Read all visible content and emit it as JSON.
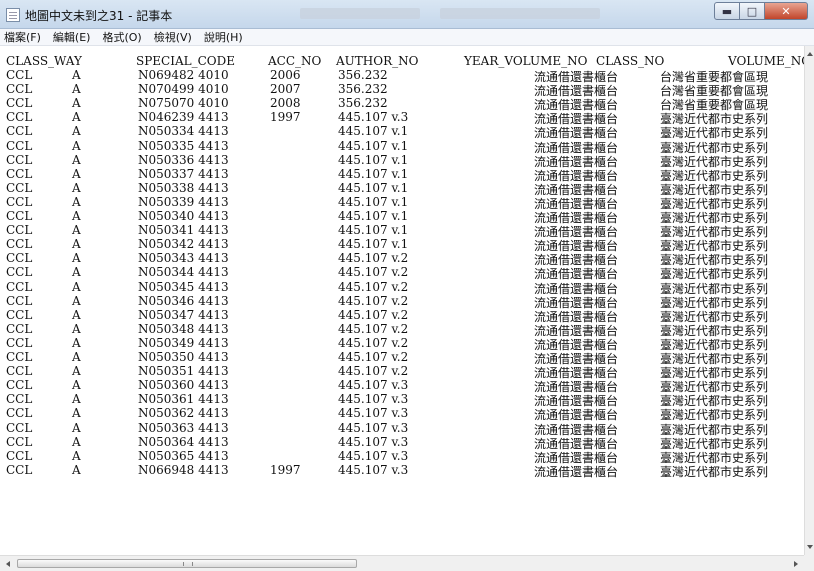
{
  "window": {
    "title": "地圖中文未到之31 - 記事本",
    "controls": {
      "minimize_icon": "minimize-icon",
      "maximize_icon": "maximize-icon",
      "close_icon": "close-icon"
    }
  },
  "menu": [
    "檔案(F)",
    "編輯(E)",
    "格式(O)",
    "檢視(V)",
    "說明(H)"
  ],
  "columns": [
    "CLASS_WAY",
    "SPECIAL_CODE",
    "ACC_NO",
    "AUTHOR_NO",
    "YEAR_VOLUME_NO",
    "CLASS_NO",
    "VOLUME_NO"
  ],
  "rows": [
    [
      "CCL",
      "A",
      "N069482 4010",
      "2006",
      "356.232",
      "",
      "流通借還書櫃台",
      "台灣省重要都會區現"
    ],
    [
      "CCL",
      "A",
      "N070499 4010",
      "2007",
      "356.232",
      "",
      "流通借還書櫃台",
      "台灣省重要都會區現"
    ],
    [
      "CCL",
      "A",
      "N075070 4010",
      "2008",
      "356.232",
      "",
      "流通借還書櫃台",
      "台灣省重要都會區現"
    ],
    [
      "CCL",
      "A",
      "N046239 4413",
      "1997",
      "445.107 v.3",
      "",
      "流通借還書櫃台",
      "臺灣近代都市史系列"
    ],
    [
      "CCL",
      "A",
      "N050334 4413",
      "",
      "445.107 v.1",
      "",
      "流通借還書櫃台",
      "臺灣近代都市史系列"
    ],
    [
      "CCL",
      "A",
      "N050335 4413",
      "",
      "445.107 v.1",
      "",
      "流通借還書櫃台",
      "臺灣近代都市史系列"
    ],
    [
      "CCL",
      "A",
      "N050336 4413",
      "",
      "445.107 v.1",
      "",
      "流通借還書櫃台",
      "臺灣近代都市史系列"
    ],
    [
      "CCL",
      "A",
      "N050337 4413",
      "",
      "445.107 v.1",
      "",
      "流通借還書櫃台",
      "臺灣近代都市史系列"
    ],
    [
      "CCL",
      "A",
      "N050338 4413",
      "",
      "445.107 v.1",
      "",
      "流通借還書櫃台",
      "臺灣近代都市史系列"
    ],
    [
      "CCL",
      "A",
      "N050339 4413",
      "",
      "445.107 v.1",
      "",
      "流通借還書櫃台",
      "臺灣近代都市史系列"
    ],
    [
      "CCL",
      "A",
      "N050340 4413",
      "",
      "445.107 v.1",
      "",
      "流通借還書櫃台",
      "臺灣近代都市史系列"
    ],
    [
      "CCL",
      "A",
      "N050341 4413",
      "",
      "445.107 v.1",
      "",
      "流通借還書櫃台",
      "臺灣近代都市史系列"
    ],
    [
      "CCL",
      "A",
      "N050342 4413",
      "",
      "445.107 v.1",
      "",
      "流通借還書櫃台",
      "臺灣近代都市史系列"
    ],
    [
      "CCL",
      "A",
      "N050343 4413",
      "",
      "445.107 v.2",
      "",
      "流通借還書櫃台",
      "臺灣近代都市史系列"
    ],
    [
      "CCL",
      "A",
      "N050344 4413",
      "",
      "445.107 v.2",
      "",
      "流通借還書櫃台",
      "臺灣近代都市史系列"
    ],
    [
      "CCL",
      "A",
      "N050345 4413",
      "",
      "445.107 v.2",
      "",
      "流通借還書櫃台",
      "臺灣近代都市史系列"
    ],
    [
      "CCL",
      "A",
      "N050346 4413",
      "",
      "445.107 v.2",
      "",
      "流通借還書櫃台",
      "臺灣近代都市史系列"
    ],
    [
      "CCL",
      "A",
      "N050347 4413",
      "",
      "445.107 v.2",
      "",
      "流通借還書櫃台",
      "臺灣近代都市史系列"
    ],
    [
      "CCL",
      "A",
      "N050348 4413",
      "",
      "445.107 v.2",
      "",
      "流通借還書櫃台",
      "臺灣近代都市史系列"
    ],
    [
      "CCL",
      "A",
      "N050349 4413",
      "",
      "445.107 v.2",
      "",
      "流通借還書櫃台",
      "臺灣近代都市史系列"
    ],
    [
      "CCL",
      "A",
      "N050350 4413",
      "",
      "445.107 v.2",
      "",
      "流通借還書櫃台",
      "臺灣近代都市史系列"
    ],
    [
      "CCL",
      "A",
      "N050351 4413",
      "",
      "445.107 v.2",
      "",
      "流通借還書櫃台",
      "臺灣近代都市史系列"
    ],
    [
      "CCL",
      "A",
      "N050360 4413",
      "",
      "445.107 v.3",
      "",
      "流通借還書櫃台",
      "臺灣近代都市史系列"
    ],
    [
      "CCL",
      "A",
      "N050361 4413",
      "",
      "445.107 v.3",
      "",
      "流通借還書櫃台",
      "臺灣近代都市史系列"
    ],
    [
      "CCL",
      "A",
      "N050362 4413",
      "",
      "445.107 v.3",
      "",
      "流通借還書櫃台",
      "臺灣近代都市史系列"
    ],
    [
      "CCL",
      "A",
      "N050363 4413",
      "",
      "445.107 v.3",
      "",
      "流通借還書櫃台",
      "臺灣近代都市史系列"
    ],
    [
      "CCL",
      "A",
      "N050364 4413",
      "",
      "445.107 v.3",
      "",
      "流通借還書櫃台",
      "臺灣近代都市史系列"
    ],
    [
      "CCL",
      "A",
      "N050365 4413",
      "",
      "445.107 v.3",
      "",
      "流通借還書櫃台",
      "臺灣近代都市史系列"
    ],
    [
      "CCL",
      "A",
      "N066948 4413",
      "1997",
      "445.107 v.3",
      "",
      "流通借還書櫃台",
      "臺灣近代都市史系列"
    ]
  ],
  "scrollbar": {
    "h_grip_label": "III"
  }
}
